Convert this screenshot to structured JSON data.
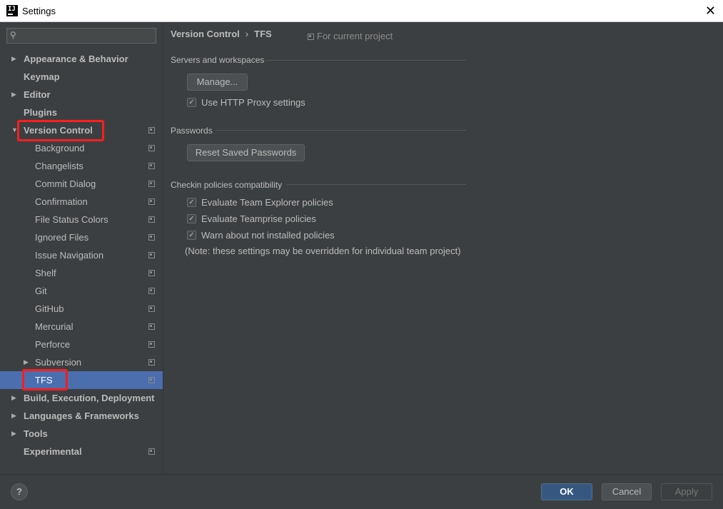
{
  "window": {
    "title": "Settings",
    "logo_text": "IJ",
    "close_glyph": "✕"
  },
  "search": {
    "placeholder": "",
    "icon": "magnifier-icon"
  },
  "sidebar": {
    "items": [
      {
        "label": "Appearance & Behavior",
        "expandable": true,
        "expanded": false
      },
      {
        "label": "Keymap"
      },
      {
        "label": "Editor",
        "expandable": true,
        "expanded": false
      },
      {
        "label": "Plugins"
      },
      {
        "label": "Version Control",
        "expandable": true,
        "expanded": true,
        "project_scoped": true
      },
      {
        "label": "Background",
        "project_scoped": true
      },
      {
        "label": "Changelists",
        "project_scoped": true
      },
      {
        "label": "Commit Dialog",
        "project_scoped": true
      },
      {
        "label": "Confirmation",
        "project_scoped": true
      },
      {
        "label": "File Status Colors",
        "project_scoped": true
      },
      {
        "label": "Ignored Files",
        "project_scoped": true
      },
      {
        "label": "Issue Navigation",
        "project_scoped": true
      },
      {
        "label": "Shelf",
        "project_scoped": true
      },
      {
        "label": "Git",
        "project_scoped": true
      },
      {
        "label": "GitHub",
        "project_scoped": true
      },
      {
        "label": "Mercurial",
        "project_scoped": true
      },
      {
        "label": "Perforce",
        "project_scoped": true
      },
      {
        "label": "Subversion",
        "expandable": true,
        "expanded": false,
        "project_scoped": true
      },
      {
        "label": "TFS",
        "selected": true,
        "project_scoped": true
      },
      {
        "label": "Build, Execution, Deployment",
        "expandable": true,
        "expanded": false
      },
      {
        "label": "Languages & Frameworks",
        "expandable": true,
        "expanded": false
      },
      {
        "label": "Tools",
        "expandable": true,
        "expanded": false
      },
      {
        "label": "Experimental",
        "project_scoped": true
      }
    ]
  },
  "main": {
    "breadcrumb": {
      "parent": "Version Control",
      "separator": "›",
      "current": "TFS"
    },
    "scope_label": "For current project",
    "sections": {
      "servers": {
        "title": "Servers and workspaces",
        "manage_button": "Manage...",
        "use_proxy_label": "Use HTTP Proxy settings",
        "use_proxy_checked": true
      },
      "passwords": {
        "title": "Passwords",
        "reset_button": "Reset Saved Passwords"
      },
      "checkin": {
        "title": "Checkin policies compatibility",
        "options": [
          {
            "label": "Evaluate Team Explorer policies",
            "checked": true
          },
          {
            "label": "Evaluate Teamprise policies",
            "checked": true
          },
          {
            "label": "Warn about not installed policies",
            "checked": true
          }
        ],
        "note": "(Note: these settings may be overridden for individual team project)"
      }
    }
  },
  "footer": {
    "help_label": "?",
    "ok_label": "OK",
    "cancel_label": "Cancel",
    "apply_label": "Apply"
  },
  "colors": {
    "background": "#3c3f41",
    "selection": "#4b6eaf",
    "ok_button": "#365880",
    "highlight_annotation": "#ff1e1e"
  }
}
